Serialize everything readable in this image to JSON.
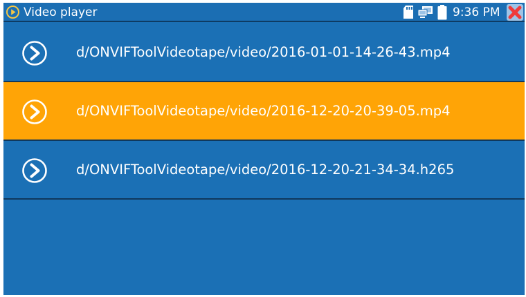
{
  "app": {
    "title": "Video player"
  },
  "status": {
    "time": "9:36 PM"
  },
  "colors": {
    "background": "#1b70b5",
    "selected": "#ffa406",
    "close": "#ef3b3b",
    "divider": "#10385c"
  },
  "icons": {
    "app": "play-circle-icon",
    "storage": "sd-card-icon",
    "network": "network-icon",
    "battery": "battery-icon",
    "close": "close-icon",
    "row": "play-arrow-icon"
  },
  "files": [
    {
      "name": "d/ONVIFToolVideotape/video/2016-01-01-14-26-43.mp4",
      "selected": false
    },
    {
      "name": "d/ONVIFToolVideotape/video/2016-12-20-20-39-05.mp4",
      "selected": true
    },
    {
      "name": "d/ONVIFToolVideotape/video/2016-12-20-21-34-34.h265",
      "selected": false
    }
  ]
}
